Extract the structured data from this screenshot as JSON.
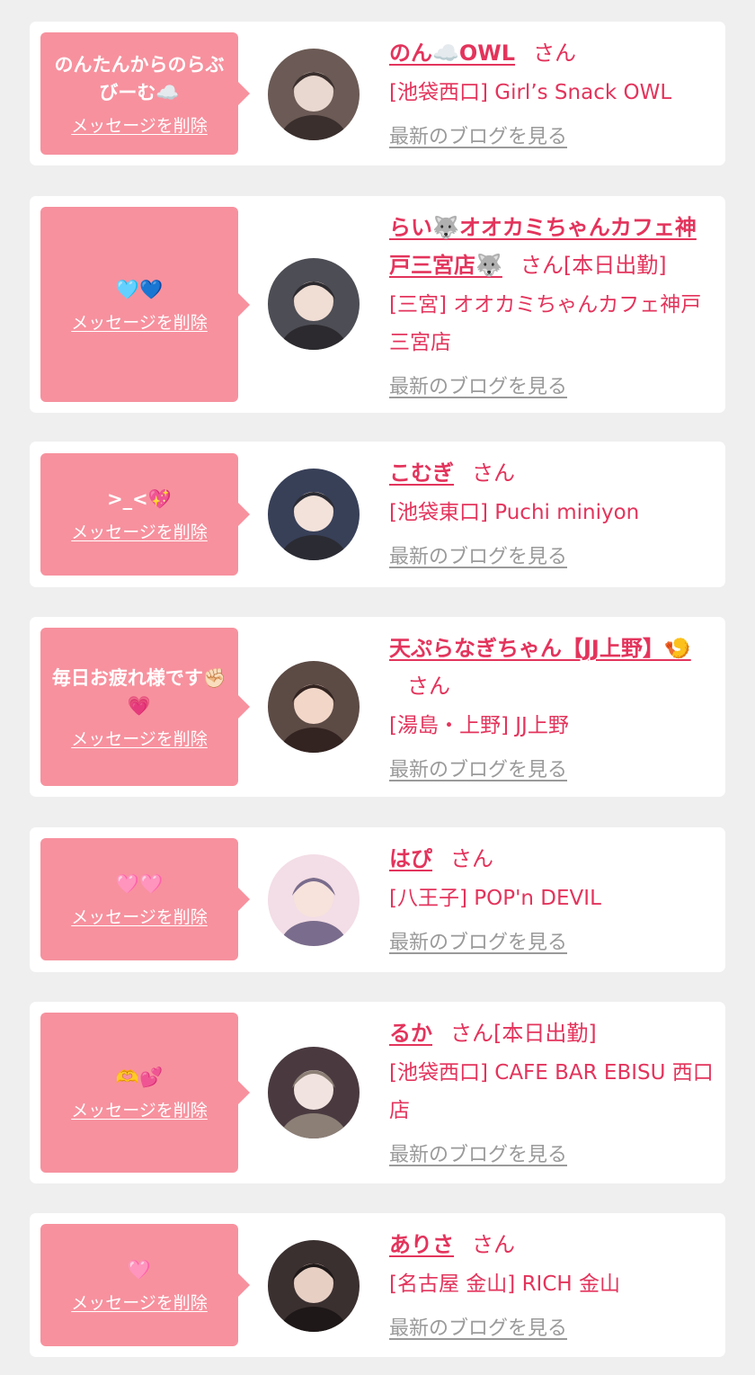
{
  "labels": {
    "delete": "メッセージを削除",
    "blog": "最新のブログを見る",
    "san": "さん",
    "today": "[本日出勤]"
  },
  "accent_color": "#e3345c",
  "bubble_color": "#f7919e",
  "cards": [
    {
      "message": "のんたんからのらぶびーむ☁️",
      "name": "のん☁️OWL",
      "today": false,
      "shop": "[池袋西口] Girl’s Snack OWL",
      "avatar_icon": "profile-photo-icon"
    },
    {
      "message": "🩵💙",
      "name": "らい🐺オオカミちゃんカフェ神戸三宮店🐺",
      "today": true,
      "shop": "[三宮] オオカミちゃんカフェ神戸三宮店",
      "avatar_icon": "profile-photo-icon"
    },
    {
      "message": ">_<💖",
      "name": "こむぎ",
      "today": false,
      "shop": "[池袋東口] Puchi miniyon",
      "avatar_icon": "profile-photo-icon"
    },
    {
      "message": "毎日お疲れ様です✊🏻💗",
      "name": "天ぷらなぎちゃん【JJ上野】🍤",
      "today": false,
      "shop": "[湯島・上野] JJ上野",
      "avatar_icon": "profile-photo-icon"
    },
    {
      "message": "🩷🩷",
      "name": "はぴ",
      "today": false,
      "shop": "[八王子] POP'n DEVIL",
      "avatar_icon": "profile-photo-icon"
    },
    {
      "message": "🫶💕",
      "name": "るか",
      "today": true,
      "shop": "[池袋西口] CAFE BAR EBISU 西口店",
      "avatar_icon": "profile-photo-icon"
    },
    {
      "message": "🩷",
      "name": "ありさ",
      "today": false,
      "shop": "[名古屋 金山] RICH 金山",
      "avatar_icon": "profile-photo-icon"
    }
  ]
}
